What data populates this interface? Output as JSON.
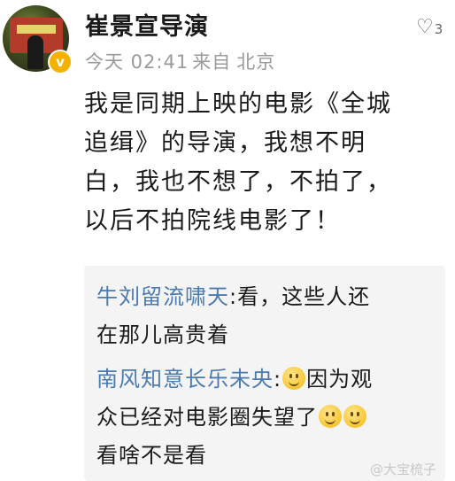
{
  "post": {
    "author": "崔景宣导演",
    "like_count": "3",
    "time": "今天 02:41",
    "source_prefix": "来自",
    "location": "北京",
    "lines": [
      "我是同期上映的电影《全城",
      "追缉》的导演，我想不明",
      "白，我也不想了，不拍了，",
      "以后不拍院线电影了！"
    ]
  },
  "comments": [
    {
      "user": "牛刘留流啸天",
      "line1": ":看，这些人还",
      "line2": "在那儿高贵着"
    },
    {
      "user": "南风知意长乐未央",
      "line1_a": ":",
      "line1_b": "因为观",
      "line2": "众已经对电影圈失望了",
      "line3": "看啥不是看"
    }
  ],
  "watermark": "@大宝梳子",
  "icons": {
    "verified": "verified-badge-icon",
    "like": "heart-outline-icon",
    "emoji": "smile-emoji-icon"
  },
  "colors": {
    "commenter_blue": "#4a7ab0",
    "meta_gray": "#9a9a9a",
    "verified_gold": "#f5b100"
  }
}
